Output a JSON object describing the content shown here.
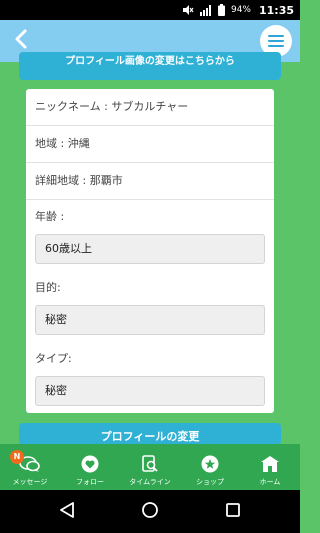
{
  "status_bar": {
    "battery": "94%",
    "time": "11:35",
    "icons": [
      "mute-icon",
      "signal-4g-icon",
      "battery-icon"
    ]
  },
  "header": {
    "back_icon": "chevron-left-icon",
    "menu_icon": "hamburger-menu-icon"
  },
  "top_button": {
    "label": "プロフィール画像の変更はこちらから"
  },
  "profile": {
    "nickname_row": "ニックネーム : サブカルチャー",
    "region_row": "地域 : 沖縄",
    "detail_region_row": "詳細地域 : 那覇市",
    "age_label": "年齢 :",
    "age_value": "60歳以上",
    "purpose_label": "目的:",
    "purpose_value": "秘密",
    "type_label": "タイプ:",
    "type_value": "秘密"
  },
  "change_button": {
    "label": "プロフィールの変更"
  },
  "bottom_nav": {
    "items": [
      {
        "label": "メッセージ",
        "icon": "chat-bubbles-icon",
        "badge": "N"
      },
      {
        "label": "フォロー",
        "icon": "heart-icon"
      },
      {
        "label": "タイムライン",
        "icon": "timeline-search-icon"
      },
      {
        "label": "ショップ",
        "icon": "star-icon"
      },
      {
        "label": "ホーム",
        "icon": "home-icon"
      }
    ]
  },
  "colors": {
    "background": "#5cc468",
    "header": "#85cdf0",
    "button": "#2fb1d5",
    "nav": "#31a752",
    "badge": "#f26a1b"
  }
}
